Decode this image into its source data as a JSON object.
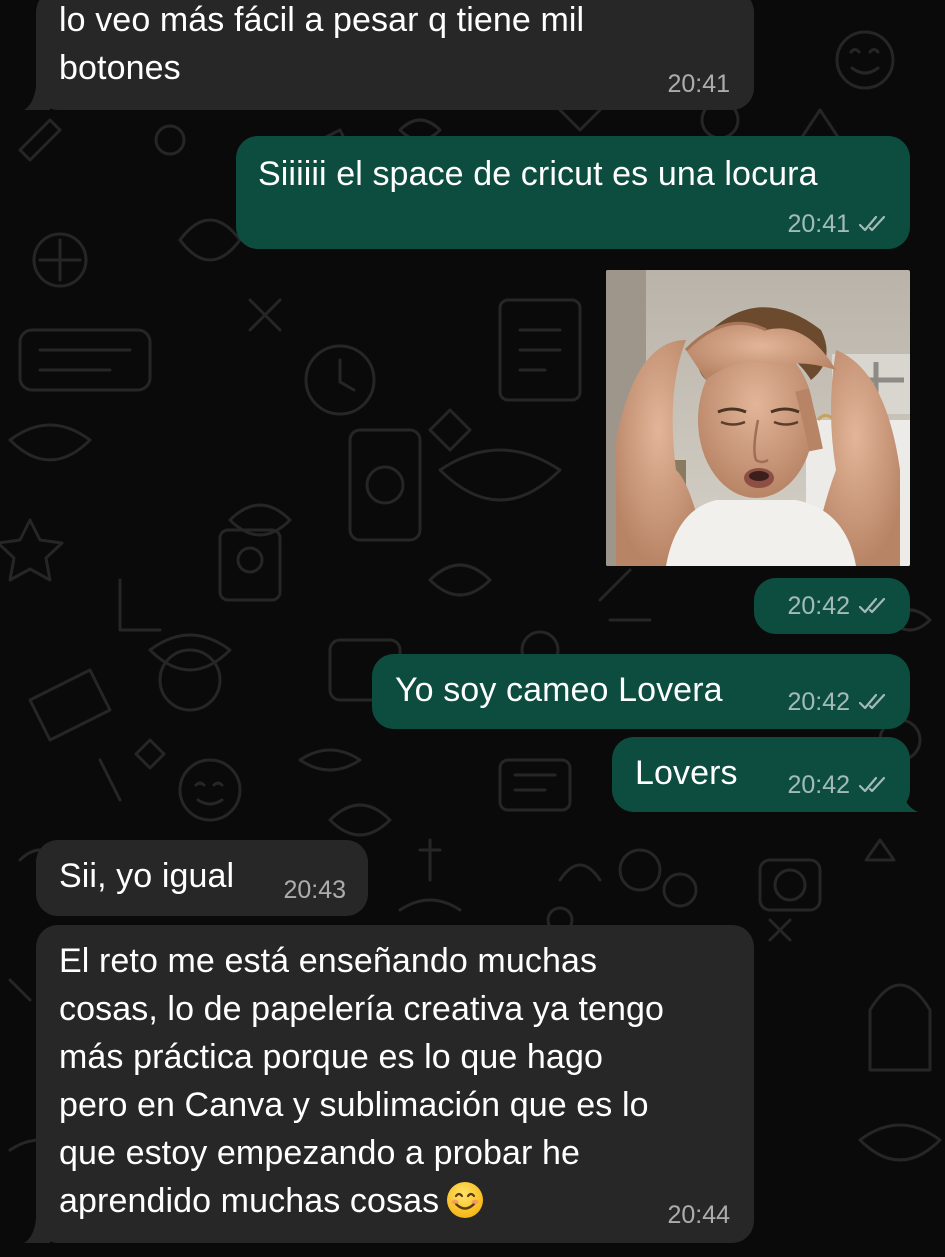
{
  "chat": {
    "messages": [
      {
        "id": "m1",
        "direction": "incoming",
        "text": "lo veo más fácil a pesar q tiene mil\nbotones",
        "time": "20:41"
      },
      {
        "id": "m2",
        "direction": "outgoing",
        "text": "Siiiiii el space de cricut es una locura",
        "time": "20:41",
        "status": "read"
      },
      {
        "id": "m3",
        "direction": "outgoing",
        "type": "image",
        "image_icon": "photo-man-hands-on-head",
        "time": "20:42",
        "status": "read"
      },
      {
        "id": "m4",
        "direction": "outgoing",
        "text": "Yo soy cameo Lovera",
        "time": "20:42",
        "status": "read"
      },
      {
        "id": "m5",
        "direction": "outgoing",
        "text": "Lovers",
        "time": "20:42",
        "status": "read"
      },
      {
        "id": "m6",
        "direction": "incoming",
        "text": "Sii, yo igual",
        "time": "20:43"
      },
      {
        "id": "m7",
        "direction": "incoming",
        "text": "El reto me está enseñando muchas\ncosas, lo de papelería creativa ya tengo\nmás práctica porque es lo que hago\npero en Canva y sublimación que es lo\nque estoy empezando a probar he\naprendido muchas cosas",
        "emoji": "😊",
        "emoji_icon": "smiling-face-icon",
        "time": "20:44"
      }
    ]
  },
  "colors": {
    "background": "#0a0a0a",
    "incoming_bubble": "#272727",
    "outgoing_bubble": "#0d4d40",
    "text": "#ffffff",
    "meta_text": "#9a9a9a"
  }
}
